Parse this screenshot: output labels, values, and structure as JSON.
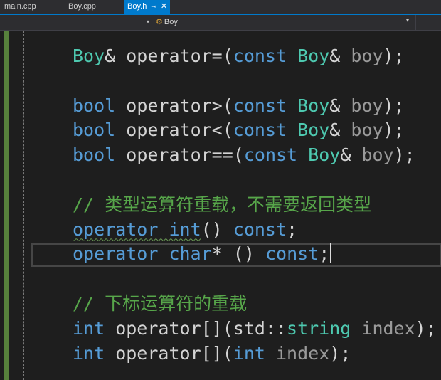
{
  "tabs": [
    {
      "label": "main.cpp",
      "active": false
    },
    {
      "label": "Boy.cpp",
      "active": false
    },
    {
      "label": "Boy.h",
      "active": true
    }
  ],
  "tab_icons": {
    "pin": "pin-icon",
    "close": "close-icon"
  },
  "navbar": {
    "scope_label": "Boy",
    "scope_icon": "class-icon",
    "dropdown_icon": "chevron-down-icon"
  },
  "code_lines": [
    {
      "parts": [
        {
          "t": "Boy",
          "c": "ty"
        },
        {
          "t": "& operator=(",
          "c": "pl"
        },
        {
          "t": "const",
          "c": "kw"
        },
        {
          "t": " ",
          "c": "pl"
        },
        {
          "t": "Boy",
          "c": "ty"
        },
        {
          "t": "& ",
          "c": "pl"
        },
        {
          "t": "boy",
          "c": "pm"
        },
        {
          "t": ");",
          "c": "pl"
        }
      ]
    },
    {
      "parts": []
    },
    {
      "parts": [
        {
          "t": "bool",
          "c": "kw"
        },
        {
          "t": " operator>(",
          "c": "pl"
        },
        {
          "t": "const",
          "c": "kw"
        },
        {
          "t": " ",
          "c": "pl"
        },
        {
          "t": "Boy",
          "c": "ty"
        },
        {
          "t": "& ",
          "c": "pl"
        },
        {
          "t": "boy",
          "c": "pm"
        },
        {
          "t": ");",
          "c": "pl"
        }
      ]
    },
    {
      "parts": [
        {
          "t": "bool",
          "c": "kw"
        },
        {
          "t": " operator<(",
          "c": "pl"
        },
        {
          "t": "const",
          "c": "kw"
        },
        {
          "t": " ",
          "c": "pl"
        },
        {
          "t": "Boy",
          "c": "ty"
        },
        {
          "t": "& ",
          "c": "pl"
        },
        {
          "t": "boy",
          "c": "pm"
        },
        {
          "t": ");",
          "c": "pl"
        }
      ]
    },
    {
      "parts": [
        {
          "t": "bool",
          "c": "kw"
        },
        {
          "t": " operator==(",
          "c": "pl"
        },
        {
          "t": "const",
          "c": "kw"
        },
        {
          "t": " ",
          "c": "pl"
        },
        {
          "t": "Boy",
          "c": "ty"
        },
        {
          "t": "& ",
          "c": "pl"
        },
        {
          "t": "boy",
          "c": "pm"
        },
        {
          "t": ");",
          "c": "pl"
        }
      ]
    },
    {
      "parts": []
    },
    {
      "parts": [
        {
          "t": "// 类型运算符重载，不需要返回类型",
          "c": "cm"
        }
      ]
    },
    {
      "parts": [
        {
          "t": "operator int",
          "c": "kw squig"
        },
        {
          "t": "() ",
          "c": "pl"
        },
        {
          "t": "const",
          "c": "kw"
        },
        {
          "t": ";",
          "c": "pl"
        }
      ]
    },
    {
      "parts": [
        {
          "t": "operator",
          "c": "kw"
        },
        {
          "t": " ",
          "c": "pl"
        },
        {
          "t": "char",
          "c": "kw"
        },
        {
          "t": "* () ",
          "c": "pl"
        },
        {
          "t": "const",
          "c": "kw"
        },
        {
          "t": ";",
          "c": "pl"
        }
      ],
      "caret": true
    },
    {
      "parts": []
    },
    {
      "parts": [
        {
          "t": "// 下标运算符的重载",
          "c": "cm"
        }
      ]
    },
    {
      "parts": [
        {
          "t": "int",
          "c": "kw"
        },
        {
          "t": " operator[](std::",
          "c": "pl"
        },
        {
          "t": "string",
          "c": "ty"
        },
        {
          "t": " ",
          "c": "pl"
        },
        {
          "t": "index",
          "c": "pm"
        },
        {
          "t": ");",
          "c": "pl"
        }
      ]
    },
    {
      "parts": [
        {
          "t": "int",
          "c": "kw"
        },
        {
          "t": " operator[](",
          "c": "pl"
        },
        {
          "t": "int",
          "c": "kw"
        },
        {
          "t": " ",
          "c": "pl"
        },
        {
          "t": "index",
          "c": "pm"
        },
        {
          "t": ");",
          "c": "pl"
        }
      ]
    }
  ],
  "colors": {
    "keyword": "#569cd6",
    "type": "#4ec9b0",
    "param": "#9a9a9a",
    "comment": "#57a64a",
    "tab_active": "#007acc"
  }
}
